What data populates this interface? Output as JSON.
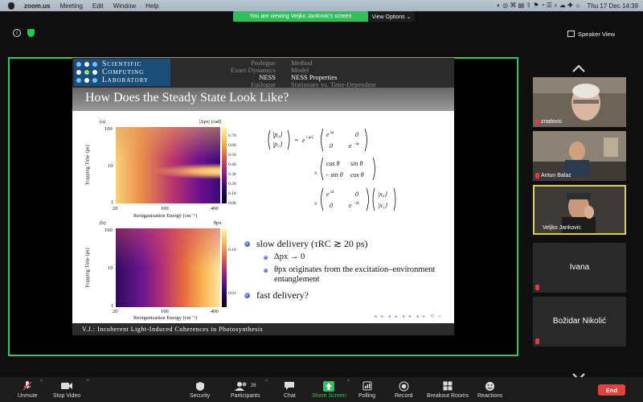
{
  "menubar": {
    "app": "zoom.us",
    "items": [
      "Meeting",
      "Edit",
      "Window",
      "Help"
    ],
    "clock": "Thu 17 Dec  14:39"
  },
  "banner": {
    "message": "You are viewing Veljko Jankovic's screen",
    "view_options": "View Options ⌄"
  },
  "speaker_view": "Speaker View",
  "slide": {
    "logo_lines": [
      "Scientific",
      "Computing",
      "Laboratory"
    ],
    "nav_left": [
      "Prologue",
      "Exact Dynamics",
      "NESS",
      "Epilogue"
    ],
    "nav_right": [
      "Method",
      "Model",
      "NESS Properties",
      "Stationary vs. Time-Dependent"
    ],
    "title": "How Does the Steady State Look Like?",
    "plot_a": {
      "panel": "(a)",
      "cbar_title": "|Δpx| (rad)",
      "ylabel": "Trapping Time (ps)",
      "xlabel": "Reorganization Energy (cm⁻¹)",
      "yticks": [
        "100",
        "10",
        "1"
      ],
      "xticks": [
        "20",
        "100",
        "400"
      ],
      "cbar_ticks": [
        "0.70",
        "0.60",
        "0.50",
        "0.40",
        "0.30",
        "0.20",
        "0.10",
        "0.00"
      ]
    },
    "plot_b": {
      "panel": "(b)",
      "cbar_title": "θpx",
      "ylabel": "Trapping Time (ps)",
      "xlabel": "Reorganization Energy (cm⁻¹)",
      "yticks": [
        "100",
        "10",
        "1"
      ],
      "xticks": [
        "20",
        "100",
        "400"
      ],
      "cbar_ticks": [
        "0.10",
        "0.01"
      ]
    },
    "bullets": {
      "b1": "slow delivery (τRC ≳ 20 ps)",
      "b1a": "Δpx → 0",
      "b1b": "θpx originates from the excitation–environment entanglement",
      "b2": "fast delivery?"
    },
    "footer": "V.J.: Incoherent Light-Induced Coherences in Photosynthesis"
  },
  "participants": [
    {
      "name": "zradovic"
    },
    {
      "name": "Antun Balaz"
    },
    {
      "name": "Veljko Jankovic"
    },
    {
      "name": "Ivana"
    },
    {
      "name": "Božidar Nikolić"
    }
  ],
  "toolbar": {
    "unmute": "Unmute",
    "stop_video": "Stop Video",
    "security": "Security",
    "participants": "Participants",
    "participants_count": "26",
    "chat": "Chat",
    "share_screen": "Share Screen",
    "polling": "Polling",
    "record": "Record",
    "breakout": "Breakout Rooms",
    "reactions": "Reactions",
    "end": "End"
  },
  "colors": {
    "share_border": "#34c759",
    "active_speaker": "#d6d04a",
    "end_button": "#e0433c",
    "share_screen_icon": "#2fbf5c"
  }
}
